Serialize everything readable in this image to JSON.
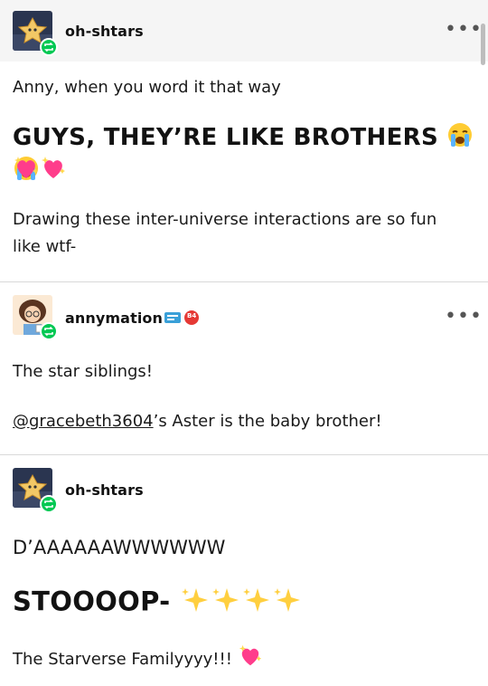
{
  "posts": [
    {
      "username": "oh-shtars",
      "paragraphs": {
        "p1": "Anny, when you word it that way",
        "big": "GUYS, THEY’RE LIKE BROTHERS",
        "p2": "Drawing these inter-universe interactions are so fun like wtf-"
      }
    },
    {
      "username": "annymation",
      "badge_text": "B4",
      "paragraphs": {
        "p1": "The star siblings!",
        "mention": "@gracebeth3604",
        "p2_rest": "’s Aster is the baby brother!"
      }
    },
    {
      "username": "oh-shtars",
      "paragraphs": {
        "p1": "D’AAAAAAWWWWWW",
        "big": "STOOOOP-",
        "p2": "The Starverse Familyyyy!!!"
      }
    }
  ],
  "icons": {
    "more": "more-options-icon",
    "reblog": "reblog-icon",
    "crying": "loudly-crying-face-emoji",
    "heart": "sparkling-heart-emoji",
    "sparkles": "sparkles-emoji"
  },
  "colors": {
    "header_bg": "#f5f5f5",
    "reblog_badge": "#00c853",
    "text": "#121212"
  }
}
